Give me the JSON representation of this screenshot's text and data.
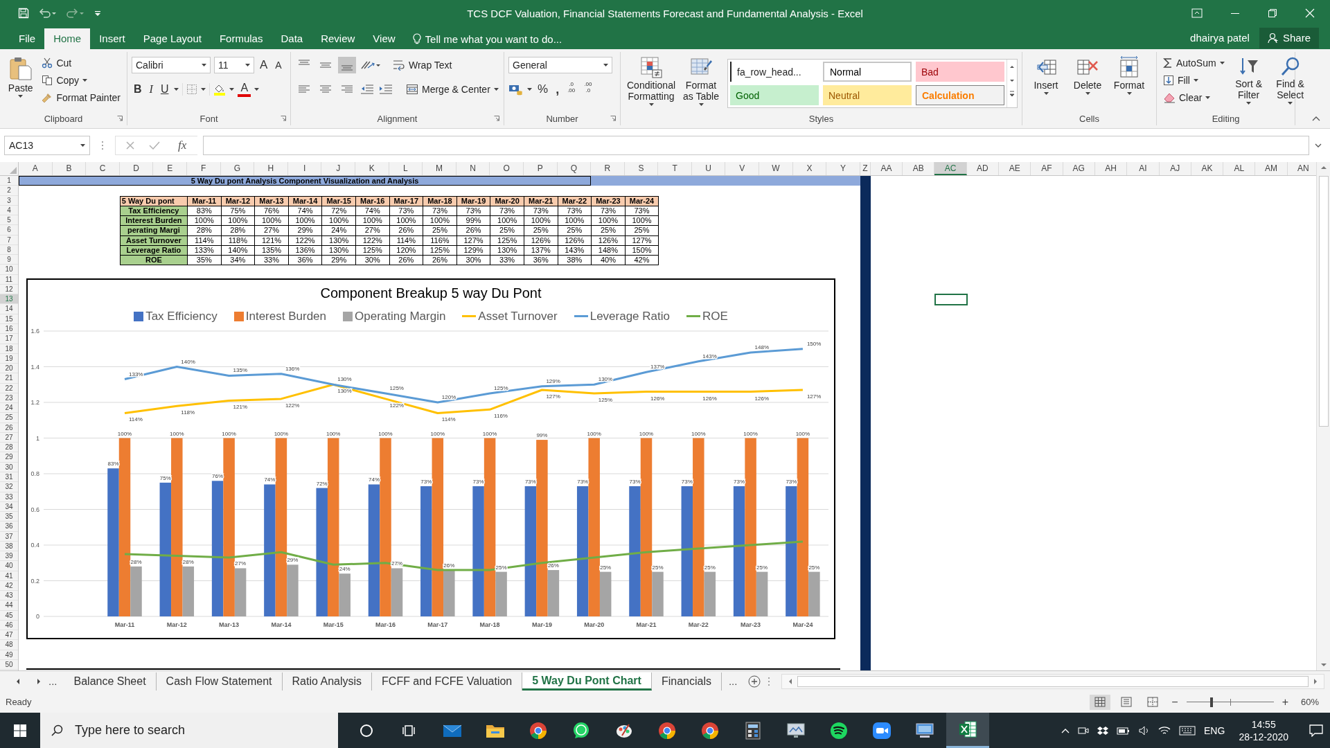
{
  "window": {
    "title": "TCS DCF Valuation, Financial Statements Forecast and Fundamental Analysis - Excel"
  },
  "menu_tabs": [
    {
      "label": "File",
      "selected": false
    },
    {
      "label": "Home",
      "selected": true
    },
    {
      "label": "Insert",
      "selected": false
    },
    {
      "label": "Page Layout",
      "selected": false
    },
    {
      "label": "Formulas",
      "selected": false
    },
    {
      "label": "Data",
      "selected": false
    },
    {
      "label": "Review",
      "selected": false
    },
    {
      "label": "View",
      "selected": false
    }
  ],
  "tell_me": {
    "placeholder": "Tell me what you want to do..."
  },
  "account": {
    "user": "dhairya patel",
    "share": "Share"
  },
  "ribbon": {
    "clipboard": {
      "label": "Clipboard",
      "paste": "Paste",
      "cut": "Cut",
      "copy": "Copy",
      "format_painter": "Format Painter"
    },
    "font": {
      "label": "Font",
      "family": "Calibri",
      "size": "11",
      "grow": "A",
      "shrink": "A",
      "bold": "B",
      "italic": "I",
      "underline": "U",
      "font_color": "A"
    },
    "alignment": {
      "label": "Alignment",
      "vertical": [
        {
          "selected": false
        },
        {
          "selected": false
        },
        {
          "selected": true
        }
      ],
      "wrap_text": "Wrap Text",
      "merge": "Merge & Center"
    },
    "number": {
      "label": "Number",
      "format": "General",
      "percent": "%",
      "comma": ",",
      "increase_decimal": [
        ".0",
        ".00"
      ],
      "decrease_decimal": [
        ".00",
        ".0"
      ]
    },
    "styles": {
      "label": "Styles",
      "conditional": "Conditional Formatting",
      "format_table": "Format as Table",
      "gallery": [
        {
          "label": "fa_row_head...",
          "kind": "custom"
        },
        {
          "label": "Normal",
          "kind": "normal"
        },
        {
          "label": "Bad",
          "kind": "bad"
        },
        {
          "label": "Good",
          "kind": "good"
        },
        {
          "label": "Neutral",
          "kind": "neutral"
        },
        {
          "label": "Calculation",
          "kind": "calculation"
        }
      ]
    },
    "cells": {
      "label": "Cells",
      "insert": "Insert",
      "delete": "Delete",
      "format": "Format"
    },
    "editing": {
      "label": "Editing",
      "autosum": "AutoSum",
      "fill": "Fill",
      "clear": "Clear",
      "sort": "Sort & Filter",
      "find": "Find & Select"
    }
  },
  "formula_bar": {
    "name_box": "AC13",
    "fx": "fx"
  },
  "sheet": {
    "columns": [
      {
        "label": "A",
        "selected": false
      },
      {
        "label": "B",
        "selected": false
      },
      {
        "label": "C",
        "selected": false
      },
      {
        "label": "D",
        "selected": false
      },
      {
        "label": "E",
        "selected": false
      },
      {
        "label": "F",
        "selected": false
      },
      {
        "label": "G",
        "selected": false
      },
      {
        "label": "H",
        "selected": false
      },
      {
        "label": "I",
        "selected": false
      },
      {
        "label": "J",
        "selected": false
      },
      {
        "label": "K",
        "selected": false
      },
      {
        "label": "L",
        "selected": false
      },
      {
        "label": "M",
        "selected": false
      },
      {
        "label": "N",
        "selected": false
      },
      {
        "label": "O",
        "selected": false
      },
      {
        "label": "P",
        "selected": false
      },
      {
        "label": "Q",
        "selected": false
      },
      {
        "label": "R",
        "selected": false
      },
      {
        "label": "S",
        "selected": false
      },
      {
        "label": "T",
        "selected": false
      },
      {
        "label": "U",
        "selected": false
      },
      {
        "label": "V",
        "selected": false
      },
      {
        "label": "W",
        "selected": false
      },
      {
        "label": "X",
        "selected": false
      },
      {
        "label": "Y",
        "selected": false
      },
      {
        "label": "Z",
        "selected": false
      },
      {
        "label": "AA",
        "selected": false
      },
      {
        "label": "AB",
        "selected": false
      },
      {
        "label": "AC",
        "selected": true
      },
      {
        "label": "AD",
        "selected": false
      },
      {
        "label": "AE",
        "selected": false
      },
      {
        "label": "AF",
        "selected": false
      },
      {
        "label": "AG",
        "selected": false
      },
      {
        "label": "AH",
        "selected": false
      },
      {
        "label": "AI",
        "selected": false
      },
      {
        "label": "AJ",
        "selected": false
      },
      {
        "label": "AK",
        "selected": false
      },
      {
        "label": "AL",
        "selected": false
      },
      {
        "label": "AM",
        "selected": false
      },
      {
        "label": "AN",
        "selected": false
      }
    ],
    "rows": [
      {
        "label": "1",
        "selected": false
      },
      {
        "label": "2",
        "selected": false
      },
      {
        "label": "3",
        "selected": false
      },
      {
        "label": "4",
        "selected": false
      },
      {
        "label": "5",
        "selected": false
      },
      {
        "label": "6",
        "selected": false
      },
      {
        "label": "7",
        "selected": false
      },
      {
        "label": "8",
        "selected": false
      },
      {
        "label": "9",
        "selected": false
      },
      {
        "label": "10",
        "selected": false
      },
      {
        "label": "11",
        "selected": false
      },
      {
        "label": "12",
        "selected": false
      },
      {
        "label": "13",
        "selected": true
      },
      {
        "label": "14",
        "selected": false
      },
      {
        "label": "15",
        "selected": false
      },
      {
        "label": "16",
        "selected": false
      },
      {
        "label": "17",
        "selected": false
      },
      {
        "label": "18",
        "selected": false
      },
      {
        "label": "19",
        "selected": false
      },
      {
        "label": "20",
        "selected": false
      },
      {
        "label": "21",
        "selected": false
      },
      {
        "label": "22",
        "selected": false
      },
      {
        "label": "23",
        "selected": false
      },
      {
        "label": "24",
        "selected": false
      },
      {
        "label": "25",
        "selected": false
      },
      {
        "label": "26",
        "selected": false
      },
      {
        "label": "27",
        "selected": false
      },
      {
        "label": "28",
        "selected": false
      },
      {
        "label": "29",
        "selected": false
      },
      {
        "label": "30",
        "selected": false
      },
      {
        "label": "31",
        "selected": false
      },
      {
        "label": "32",
        "selected": false
      },
      {
        "label": "33",
        "selected": false
      },
      {
        "label": "34",
        "selected": false
      },
      {
        "label": "35",
        "selected": false
      },
      {
        "label": "36",
        "selected": false
      },
      {
        "label": "37",
        "selected": false
      },
      {
        "label": "38",
        "selected": false
      },
      {
        "label": "39",
        "selected": false
      },
      {
        "label": "40",
        "selected": false
      },
      {
        "label": "41",
        "selected": false
      },
      {
        "label": "42",
        "selected": false
      },
      {
        "label": "43",
        "selected": false
      },
      {
        "label": "44",
        "selected": false
      },
      {
        "label": "45",
        "selected": false
      },
      {
        "label": "46",
        "selected": false
      },
      {
        "label": "47",
        "selected": false
      },
      {
        "label": "48",
        "selected": false
      },
      {
        "label": "49",
        "selected": false
      },
      {
        "label": "50",
        "selected": false
      }
    ],
    "banner": "5 Way Du pont Analysis Component Visualization and Analysis",
    "table": {
      "corner": "5 Way Du pont",
      "columns": [
        "Mar-11",
        "Mar-12",
        "Mar-13",
        "Mar-14",
        "Mar-15",
        "Mar-16",
        "Mar-17",
        "Mar-18",
        "Mar-19",
        "Mar-20",
        "Mar-21",
        "Mar-22",
        "Mar-23",
        "Mar-24"
      ],
      "rows": [
        {
          "label": "Tax Efficiency",
          "cells": [
            "83%",
            "75%",
            "76%",
            "74%",
            "72%",
            "74%",
            "73%",
            "73%",
            "73%",
            "73%",
            "73%",
            "73%",
            "73%",
            "73%"
          ]
        },
        {
          "label": "Interest Burden",
          "cells": [
            "100%",
            "100%",
            "100%",
            "100%",
            "100%",
            "100%",
            "100%",
            "100%",
            "99%",
            "100%",
            "100%",
            "100%",
            "100%",
            "100%"
          ]
        },
        {
          "label": "perating Margi",
          "cells": [
            "28%",
            "28%",
            "27%",
            "29%",
            "24%",
            "27%",
            "26%",
            "25%",
            "26%",
            "25%",
            "25%",
            "25%",
            "25%",
            "25%"
          ]
        },
        {
          "label": "Asset Turnover",
          "cells": [
            "114%",
            "118%",
            "121%",
            "122%",
            "130%",
            "122%",
            "114%",
            "116%",
            "127%",
            "125%",
            "126%",
            "126%",
            "126%",
            "127%"
          ]
        },
        {
          "label": "Leverage Ratio",
          "cells": [
            "133%",
            "140%",
            "135%",
            "136%",
            "130%",
            "125%",
            "120%",
            "125%",
            "129%",
            "130%",
            "137%",
            "143%",
            "148%",
            "150%"
          ]
        },
        {
          "label": "ROE",
          "cells": [
            "35%",
            "34%",
            "33%",
            "36%",
            "29%",
            "30%",
            "26%",
            "26%",
            "30%",
            "33%",
            "36%",
            "38%",
            "40%",
            "42%"
          ]
        }
      ]
    },
    "chart": {
      "chart_data": {
        "type": "bar",
        "title": "Component Breakup 5 way Du Pont",
        "categories": [
          "Mar-11",
          "Mar-12",
          "Mar-13",
          "Mar-14",
          "Mar-15",
          "Mar-16",
          "Mar-17",
          "Mar-18",
          "Mar-19",
          "Mar-20",
          "Mar-21",
          "Mar-22",
          "Mar-23",
          "Mar-24"
        ],
        "grid": true,
        "legend": true,
        "ylim": [
          0,
          1.6
        ],
        "yticks": [
          {
            "value": 0,
            "label": "0"
          },
          {
            "value": 0.2,
            "label": "0.2"
          },
          {
            "value": 0.4,
            "label": "0.4"
          },
          {
            "value": 0.6,
            "label": "0.6"
          },
          {
            "value": 0.8,
            "label": "0.8"
          },
          {
            "value": 1,
            "label": "1"
          },
          {
            "value": 1.2,
            "label": "1.2"
          },
          {
            "value": 1.4,
            "label": "1.4"
          },
          {
            "value": 1.6,
            "label": "1.6"
          }
        ],
        "series": [
          {
            "name": "Tax Efficiency",
            "color": "#4472c4",
            "values": [
              0.83,
              0.75,
              0.76,
              0.74,
              0.72,
              0.74,
              0.73,
              0.73,
              0.73,
              0.73,
              0.73,
              0.73,
              0.73,
              0.73
            ],
            "value_labels": [
              "83%",
              "75%",
              "76%",
              "74%",
              "72%",
              "74%",
              "73%",
              "73%",
              "73%",
              "73%",
              "73%",
              "73%",
              "73%",
              "73%"
            ]
          },
          {
            "name": "Interest Burden",
            "color": "#ed7d31",
            "values": [
              1,
              1,
              1,
              1,
              1,
              1,
              1,
              1,
              0.99,
              1,
              1,
              1,
              1,
              1
            ],
            "value_labels": [
              "100%",
              "100%",
              "100%",
              "100%",
              "100%",
              "100%",
              "100%",
              "100%",
              "99%",
              "100%",
              "100%",
              "100%",
              "100%",
              "100%"
            ]
          },
          {
            "name": "Operating Margin",
            "color": "#a5a5a5",
            "values": [
              0.28,
              0.28,
              0.27,
              0.29,
              0.24,
              0.27,
              0.26,
              0.25,
              0.26,
              0.25,
              0.25,
              0.25,
              0.25,
              0.25
            ],
            "value_labels": [
              "28%",
              "28%",
              "27%",
              "29%",
              "24%",
              "27%",
              "26%",
              "25%",
              "26%",
              "25%",
              "25%",
              "25%",
              "25%",
              "25%"
            ]
          },
          {
            "name": "Asset Turnover",
            "type": "line",
            "color": "#ffc000",
            "values": [
              1.14,
              1.18,
              1.21,
              1.22,
              1.3,
              1.22,
              1.14,
              1.16,
              1.27,
              1.25,
              1.26,
              1.26,
              1.26,
              1.27
            ],
            "value_labels": [
              "114%",
              "118%",
              "121%",
              "122%",
              "130%",
              "122%",
              "114%",
              "116%",
              "127%",
              "125%",
              "126%",
              "126%",
              "126%",
              "127%"
            ]
          },
          {
            "name": "Leverage Ratio",
            "type": "line",
            "color": "#5b9bd5",
            "values": [
              1.33,
              1.4,
              1.35,
              1.36,
              1.3,
              1.25,
              1.2,
              1.25,
              1.29,
              1.3,
              1.37,
              1.43,
              1.48,
              1.5
            ],
            "value_labels": [
              "133%",
              "140%",
              "135%",
              "136%",
              "130%",
              "125%",
              "120%",
              "125%",
              "129%",
              "130%",
              "137%",
              "143%",
              "148%",
              "150%"
            ]
          },
          {
            "name": "ROE",
            "type": "line",
            "color": "#70ad47",
            "values": [
              0.35,
              0.34,
              0.33,
              0.36,
              0.29,
              0.3,
              0.26,
              0.26,
              0.3,
              0.33,
              0.36,
              0.38,
              0.4,
              0.42
            ]
          }
        ]
      }
    }
  },
  "sheet_tabs": {
    "more_left": "...",
    "more_right": "...",
    "tabs": [
      {
        "label": "Balance Sheet",
        "selected": false
      },
      {
        "label": "Cash Flow Statement",
        "selected": false
      },
      {
        "label": "Ratio Analysis",
        "selected": false
      },
      {
        "label": "FCFF and FCFE Valuation",
        "selected": false
      },
      {
        "label": "5 Way Du Pont Chart",
        "selected": true
      },
      {
        "label": "Financials",
        "selected": false
      }
    ]
  },
  "status_bar": {
    "ready": "Ready",
    "views": [
      {
        "selected": true
      },
      {
        "selected": false
      },
      {
        "selected": false
      }
    ],
    "zoom_out": "−",
    "zoom_in": "+",
    "zoom_slider": {
      "level": 0.29
    },
    "zoom": "60%"
  },
  "taskbar": {
    "search": {
      "placeholder": "Type here to search"
    },
    "apps": [
      {
        "kind": "cortana",
        "active": false
      },
      {
        "kind": "taskview",
        "active": false
      },
      {
        "kind": "mail",
        "active": false
      },
      {
        "kind": "folder",
        "active": false
      },
      {
        "kind": "chrome",
        "active": false
      },
      {
        "kind": "whatsapp",
        "active": false
      },
      {
        "kind": "paint",
        "active": false
      },
      {
        "kind": "chrome",
        "active": false
      },
      {
        "kind": "chrome",
        "active": false
      },
      {
        "kind": "calculator",
        "active": false
      },
      {
        "kind": "monitor",
        "active": false
      },
      {
        "kind": "spotify",
        "active": false
      },
      {
        "kind": "zoom",
        "active": false
      },
      {
        "kind": "remote",
        "active": false
      },
      {
        "kind": "excel",
        "active": true
      }
    ],
    "language": "ENG",
    "time": "14:55",
    "date": "28-12-2020"
  }
}
